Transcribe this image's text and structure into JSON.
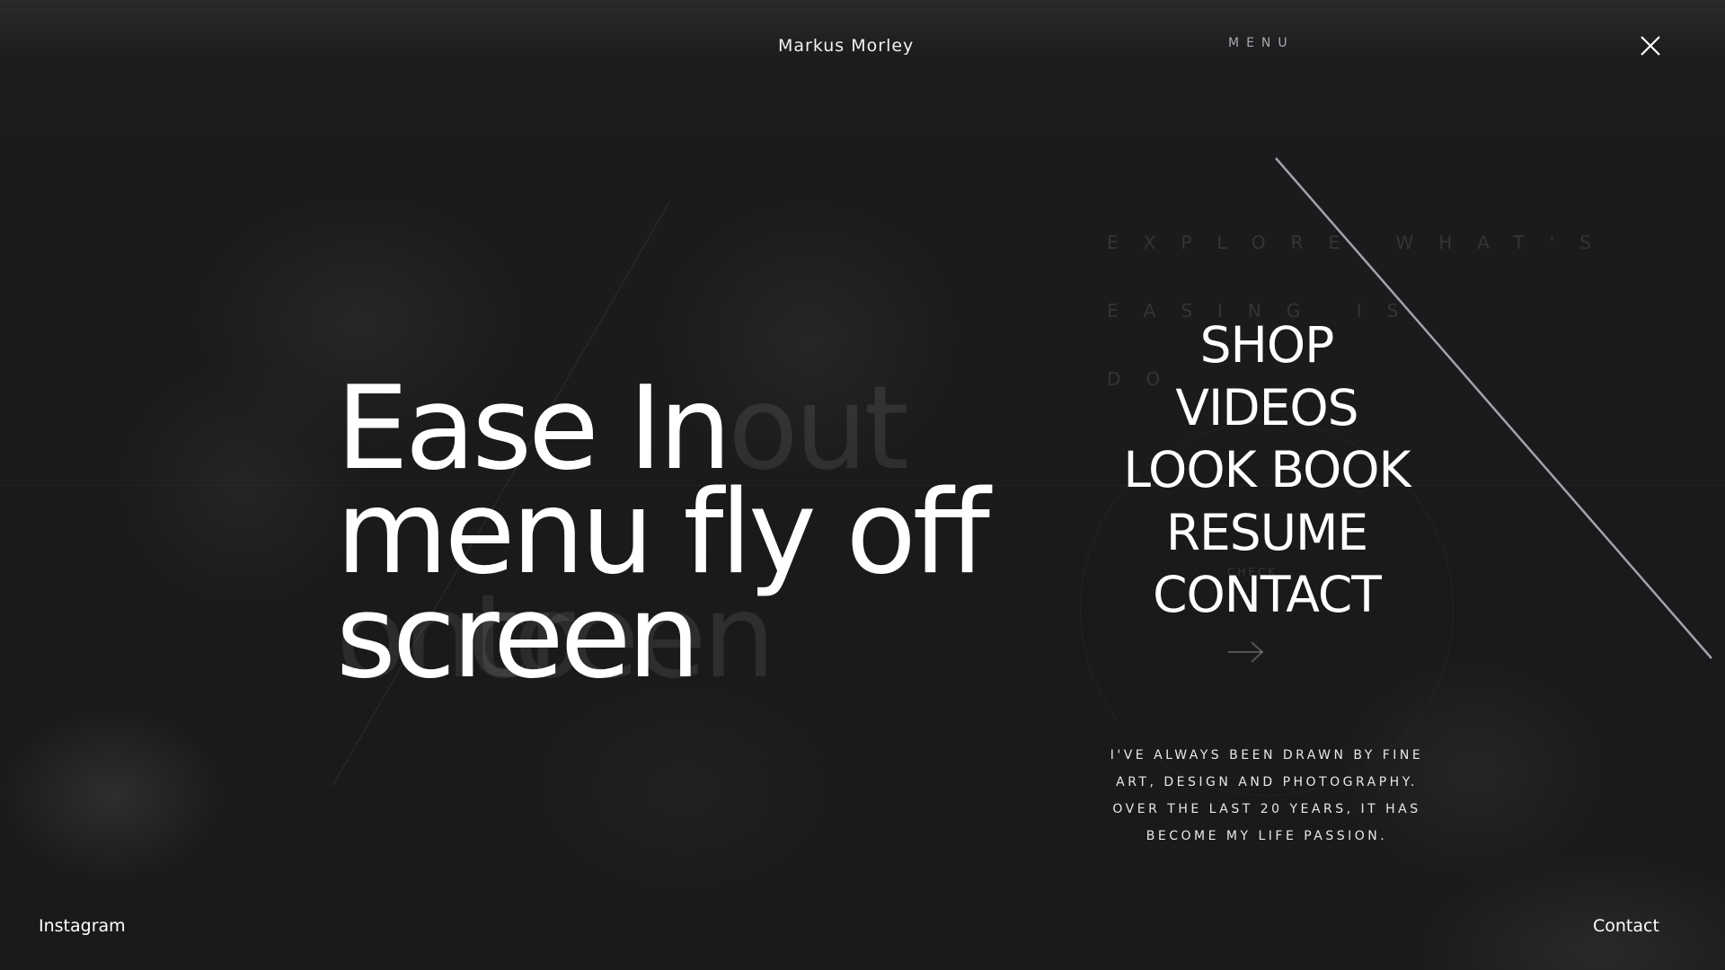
{
  "header": {
    "brand": "Markus Morley",
    "menu_label": "MENU",
    "close_icon": "close-icon"
  },
  "background": {
    "ghost_explore_lines": [
      "EXPLORE WHAT'S",
      "EASING IS",
      "DO"
    ],
    "ghost_small": "CHECK",
    "ghost_arrow_icon": "arrow-right-icon"
  },
  "headline": {
    "line1": "Ease In",
    "line1_ghost": "out",
    "line2": "menu fly off",
    "line3": "screen",
    "line3_ghost_under": "onto",
    "line3_ghost_after": "creen"
  },
  "menu": {
    "items": [
      {
        "label": "SHOP"
      },
      {
        "label": "VIDEOS"
      },
      {
        "label": "LOOK BOOK"
      },
      {
        "label": "RESUME"
      },
      {
        "label": "CONTACT"
      }
    ]
  },
  "bio": {
    "lines": [
      "I'VE ALWAYS BEEN DRAWN BY FINE",
      "ART, DESIGN AND PHOTOGRAPHY.",
      "OVER THE LAST 20 YEARS, IT HAS",
      "BECOME MY LIFE PASSION."
    ]
  },
  "footer": {
    "left_link": "Instagram",
    "right_link": "Contact"
  },
  "colors": {
    "background": "#1b1b1d",
    "text": "#ffffff",
    "muted": "#a9a9ad"
  }
}
